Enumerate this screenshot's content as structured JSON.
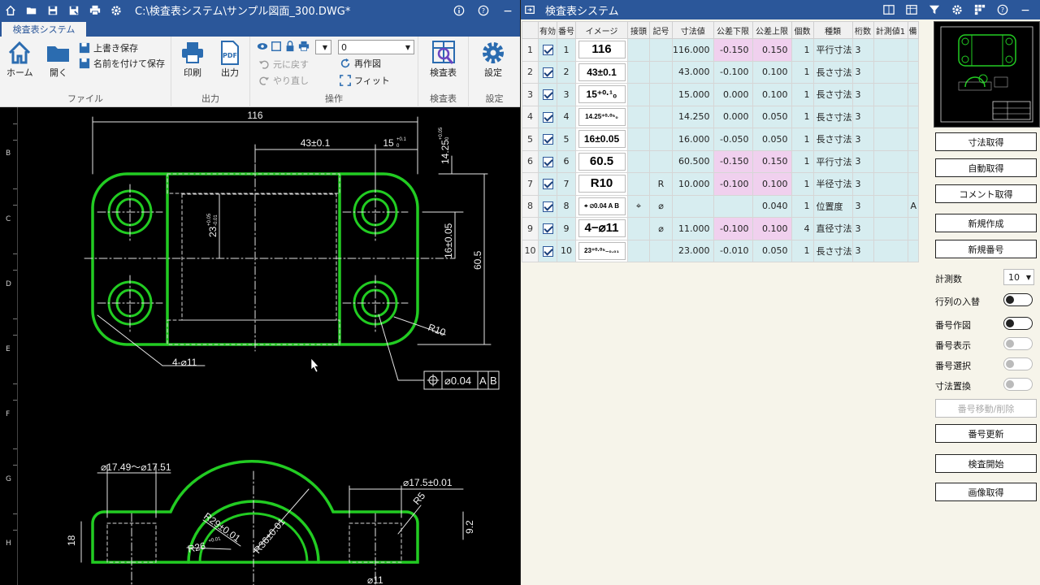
{
  "cad": {
    "title": "C:\\検査表システム\\サンプル図面_300.DWG*",
    "tab": "検査表システム",
    "groups": {
      "file": "ファイル",
      "output": "出力",
      "operation": "操作",
      "inspection": "検査表",
      "settings": "設定"
    },
    "buttons": {
      "home": "ホーム",
      "open": "開く",
      "overwrite_save": "上書き保存",
      "save_as": "名前を付けて保存",
      "print": "印刷",
      "pdf_top": "PDF",
      "pdf_output": "出力",
      "undo": "元に戻す",
      "redo": "やり直し",
      "redraw": "再作図",
      "fit": "フィット",
      "inspection_table": "検査表",
      "settings": "設定"
    },
    "layer_value": "0",
    "ruler_labels": [
      "B",
      "C",
      "D",
      "E",
      "F",
      "G",
      "H"
    ],
    "drawing": {
      "dims": {
        "width": "116",
        "d43": "43±0.1",
        "d15": "15",
        "d15_tol": "+0.1",
        "d15_tol2": "0",
        "d1425": "14.25",
        "d1425_tol": "+0.05",
        "d1425_tol2": "0",
        "d23": "23",
        "d23_tol": "+0.05",
        "d23_tol2": "-0.01",
        "d16": "16±0.05",
        "d605": "60.5",
        "r10": "R10",
        "holes": "4-⌀11",
        "pos_tol": "⌀0.04",
        "datum_a": "A",
        "datum_b": "B",
        "d1749": "⌀17.49～⌀17.51",
        "d175": "⌀17.5±0.01",
        "r5": "R5",
        "d92": "9.2",
        "d18": "18",
        "r29": "R29±0.01",
        "r26": "R26",
        "r26_tol": "+0.01",
        "r36": "R36±0.01",
        "d11": "⌀11"
      }
    }
  },
  "inspection": {
    "title": "検査表システム",
    "columns": [
      "",
      "有効",
      "番号",
      "イメージ",
      "接頭",
      "記号",
      "寸法値",
      "公差下限",
      "公差上限",
      "個数",
      "種類",
      "桁数",
      "計測値1",
      "備"
    ],
    "rows": [
      {
        "n": "1",
        "no": "1",
        "img": "116",
        "prefix": "",
        "sym": "",
        "val": "116.000",
        "lo": "-0.150",
        "hi": "0.150",
        "qty": "1",
        "type": "平行寸法",
        "digits": "3",
        "m1": "",
        "extra": "",
        "pink": true
      },
      {
        "n": "2",
        "no": "2",
        "img": "43±0.1",
        "prefix": "",
        "sym": "",
        "val": "43.000",
        "lo": "-0.100",
        "hi": "0.100",
        "qty": "1",
        "type": "長さ寸法",
        "digits": "3",
        "m1": "",
        "extra": "",
        "pink": false
      },
      {
        "n": "3",
        "no": "3",
        "img": "15⁺⁰·¹₀",
        "prefix": "",
        "sym": "",
        "val": "15.000",
        "lo": "0.000",
        "hi": "0.100",
        "qty": "1",
        "type": "長さ寸法",
        "digits": "3",
        "m1": "",
        "extra": "",
        "pink": false
      },
      {
        "n": "4",
        "no": "4",
        "img": "14.25⁺⁰·⁰⁵₀",
        "prefix": "",
        "sym": "",
        "val": "14.250",
        "lo": "0.000",
        "hi": "0.050",
        "qty": "1",
        "type": "長さ寸法",
        "digits": "3",
        "m1": "",
        "extra": "",
        "pink": false
      },
      {
        "n": "5",
        "no": "5",
        "img": "16±0.05",
        "prefix": "",
        "sym": "",
        "val": "16.000",
        "lo": "-0.050",
        "hi": "0.050",
        "qty": "1",
        "type": "長さ寸法",
        "digits": "3",
        "m1": "",
        "extra": "",
        "pink": false
      },
      {
        "n": "6",
        "no": "6",
        "img": "60.5",
        "prefix": "",
        "sym": "",
        "val": "60.500",
        "lo": "-0.150",
        "hi": "0.150",
        "qty": "1",
        "type": "平行寸法",
        "digits": "3",
        "m1": "",
        "extra": "",
        "pink": true
      },
      {
        "n": "7",
        "no": "7",
        "img": "R10",
        "prefix": "",
        "sym": "R",
        "val": "10.000",
        "lo": "-0.100",
        "hi": "0.100",
        "qty": "1",
        "type": "半径寸法",
        "digits": "3",
        "m1": "",
        "extra": "",
        "pink": true
      },
      {
        "n": "8",
        "no": "8",
        "img": "⌖ ⌀0.04 A B",
        "prefix": "⌖",
        "sym": "⌀",
        "val": "",
        "lo": "",
        "hi": "0.040",
        "qty": "1",
        "type": "位置度",
        "digits": "3",
        "m1": "",
        "extra": "A",
        "pink": false
      },
      {
        "n": "9",
        "no": "9",
        "img": "4−⌀11",
        "prefix": "",
        "sym": "⌀",
        "val": "11.000",
        "lo": "-0.100",
        "hi": "0.100",
        "qty": "4",
        "type": "直径寸法",
        "digits": "3",
        "m1": "",
        "extra": "",
        "pink": true
      },
      {
        "n": "10",
        "no": "10",
        "img": "23⁺⁰·⁰⁵₋₀.₀₁",
        "prefix": "",
        "sym": "",
        "val": "23.000",
        "lo": "-0.010",
        "hi": "0.050",
        "qty": "1",
        "type": "長さ寸法",
        "digits": "3",
        "m1": "",
        "extra": "",
        "pink": false
      }
    ],
    "panel": {
      "get_dimension": "寸法取得",
      "auto_get": "自動取得",
      "get_comment": "コメント取得",
      "new_create": "新規作成",
      "new_number": "新規番号",
      "measure_count_label": "計測数",
      "measure_count": "10",
      "swap_rows_cols": "行列の入替",
      "number_draw": "番号作図",
      "number_show": "番号表示",
      "number_select": "番号選択",
      "dim_replace": "寸法置換",
      "number_move_delete": "番号移動/削除",
      "number_update": "番号更新",
      "start_inspection": "検査開始",
      "get_image": "画像取得"
    }
  }
}
